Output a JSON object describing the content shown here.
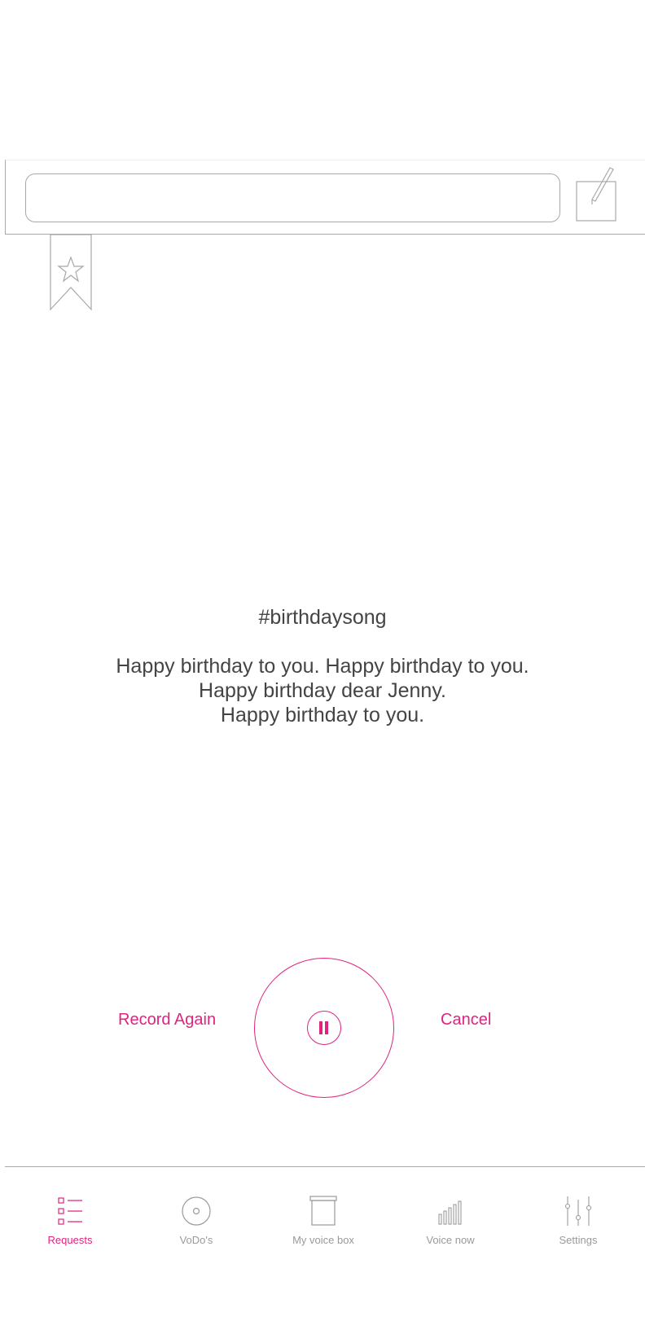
{
  "search": {
    "value": "",
    "placeholder": ""
  },
  "icons": {
    "edit": "pencil-square-icon",
    "bookmark": "star-bookmark-icon",
    "pause": "pause-icon"
  },
  "content": {
    "hashtag": "#birthdaysong",
    "lyrics": [
      "Happy birthday to you. Happy birthday to you.",
      "Happy birthday dear Jenny.",
      "Happy birthday to you."
    ]
  },
  "controls": {
    "record_again_label": "Record Again",
    "cancel_label": "Cancel",
    "state": "recording"
  },
  "nav": {
    "items": [
      {
        "label": "Requests",
        "icon": "list-icon",
        "active": true
      },
      {
        "label": "VoDo's",
        "icon": "disc-icon",
        "active": false
      },
      {
        "label": "My voice box",
        "icon": "box-icon",
        "active": false
      },
      {
        "label": "Voice now",
        "icon": "bars-icon",
        "active": false
      },
      {
        "label": "Settings",
        "icon": "sliders-icon",
        "active": false
      }
    ]
  },
  "colors": {
    "accent": "#e0237f",
    "text": "#444444",
    "muted": "#9a9a9a",
    "lines": "#a8a8a8"
  }
}
